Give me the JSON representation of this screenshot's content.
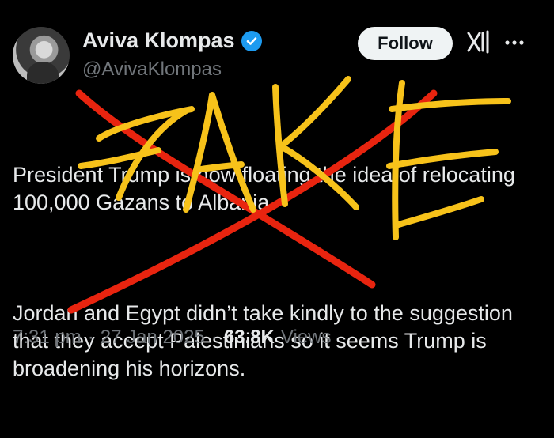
{
  "author": {
    "display_name": "Aviva Klompas",
    "handle": "@AvivaKlompas",
    "verified": true
  },
  "actions": {
    "follow_label": "Follow",
    "icons": [
      "grok-icon",
      "more-icon",
      "verified-badge-icon"
    ]
  },
  "tweet": {
    "paragraphs": [
      "President Trump is now floating the idea of relocating 100,000 Gazans to Albania.",
      "Jordan and Egypt didn’t take kindly to the suggestion that they accept Palestinians so it seems Trump is broadening his horizons."
    ]
  },
  "meta": {
    "time": "7:31 pm",
    "date": "27 Jan 2025",
    "views_count": "63.8K",
    "views_label": "Views",
    "separator": "·"
  },
  "overlay": {
    "word": "FAKE",
    "colors": {
      "letters": "#f7c21a",
      "cross": "#e8240f"
    }
  },
  "colors": {
    "background": "#000000",
    "text": "#e7e9ea",
    "muted": "#71767b",
    "verified": "#1d9bf0",
    "follow_bg": "#eff3f4"
  }
}
